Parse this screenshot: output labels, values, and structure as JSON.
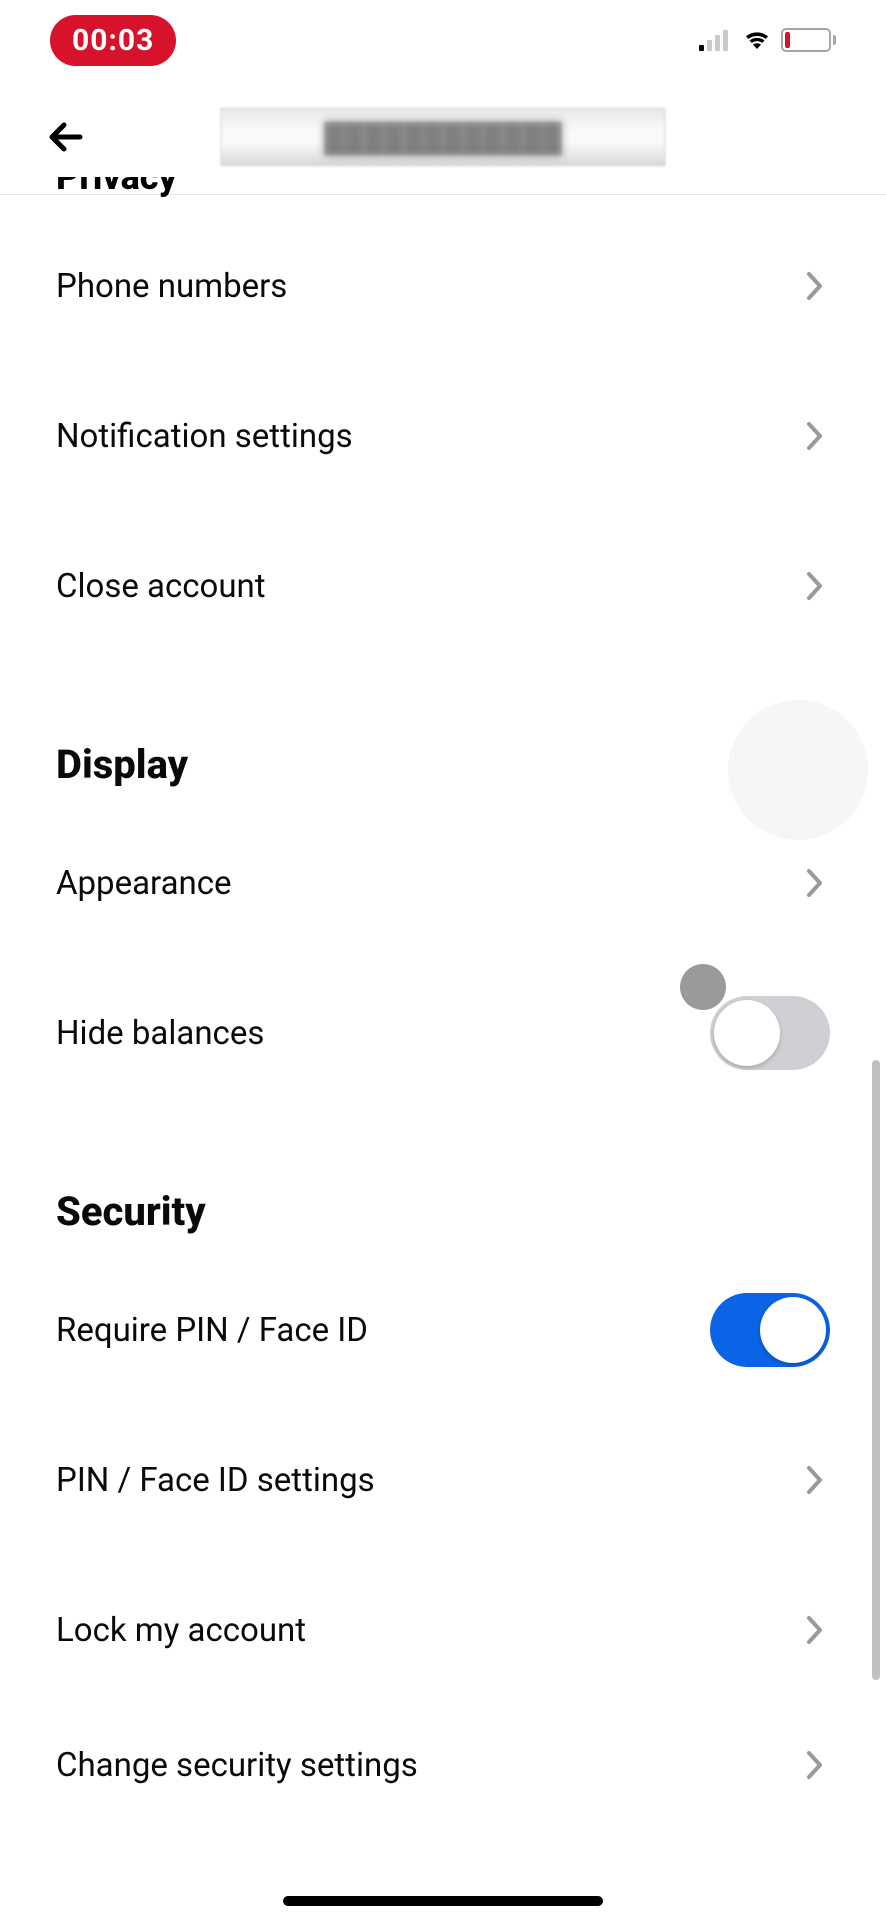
{
  "statusBar": {
    "time": "00:03",
    "batteryText": "13"
  },
  "header": {
    "blurredTitle": "████████████"
  },
  "sections": {
    "partialHeading": "Privacy",
    "displayHeading": "Display",
    "securityHeading": "Security"
  },
  "items": {
    "phoneNumbers": "Phone numbers",
    "notificationSettings": "Notification settings",
    "closeAccount": "Close account",
    "appearance": "Appearance",
    "hideBalances": "Hide balances",
    "requirePin": "Require PIN / Face ID",
    "pinSettings": "PIN / Face ID settings",
    "lockAccount": "Lock my account",
    "changeSecurity": "Change security settings"
  },
  "toggles": {
    "hideBalances": false,
    "requirePin": true
  }
}
